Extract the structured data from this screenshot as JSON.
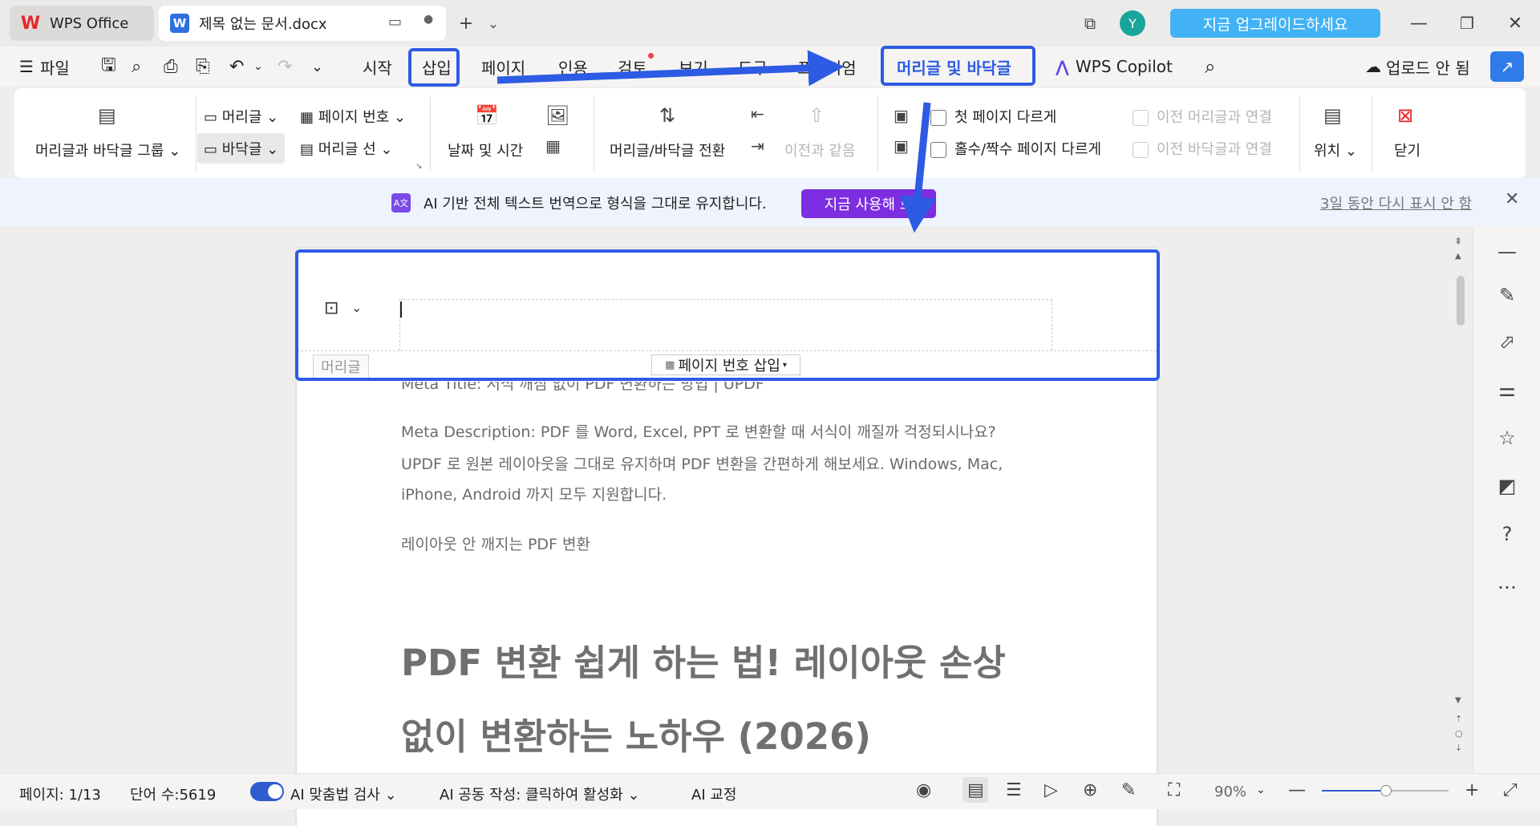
{
  "titlebar": {
    "tab_wps": "WPS Office",
    "tab_doc": "제목 없는 문서.docx",
    "avatar": "Y",
    "upgrade": "지금 업그레이드하세요"
  },
  "menubar": {
    "file": "파일",
    "tabs": [
      "시작",
      "삽입",
      "페이지",
      "인용",
      "검토",
      "보기",
      "도구",
      "프리미엄"
    ],
    "active_tab": "머리글 및 바닥글",
    "copilot": "WPS Copilot",
    "upload": "업로드 안 됨"
  },
  "ribbon": {
    "hf_group": "머리글과 바닥글 그룹",
    "header": "머리글",
    "footer": "바닥글",
    "page_number": "페이지 번호",
    "header_line": "머리글 선",
    "date_time": "날짜 및 시간",
    "switch": "머리글/바닥글 전환",
    "same_as_prev": "이전과 같음",
    "first_page_diff": "첫 페이지 다르게",
    "odd_even_diff": "홀수/짝수 페이지 다르게",
    "link_prev_header": "이전 머리글과 연결",
    "link_prev_footer": "이전 바닥글과 연결",
    "position": "위치",
    "close": "닫기"
  },
  "notification": {
    "badge": "A文",
    "text": "AI 기반 전체 텍스트 번역으로 형식을 그대로 유지합니다.",
    "button": "지금 사용해 보",
    "dismiss": "3일 동안 다시 표시 안 함"
  },
  "document": {
    "header_label": "머리글",
    "insert_page_number": "페이지 번호 삽입",
    "meta_title": "Meta Title: 서식 깨짐 없이 PDF 변환하는 방법 | UPDF",
    "meta_desc_1": "Meta Description: PDF 를 Word, Excel, PPT 로 변환할 때 서식이 깨질까 걱정되시나요?",
    "meta_desc_2": "UPDF 로 원본 레이아웃을 그대로 유지하며 PDF 변환을 간편하게 해보세요. Windows, Mac,",
    "meta_desc_3": "iPhone, Android 까지 모두 지원합니다.",
    "keyword": "레이아웃 안 깨지는 PDF 변환",
    "heading_1": "PDF 변환 쉽게 하는 법! 레이아웃 손상",
    "heading_2": "없이 변환하는 노하우 (2026)"
  },
  "statusbar": {
    "page": "페이지: 1/13",
    "words": "단어 수:5619",
    "spellcheck": "AI 맞춤법 검사",
    "coauthor": "AI 공동 작성: 클릭하여 활성화",
    "proofread": "AI 교정",
    "zoom": "90%",
    "zoom_level": 0.5
  },
  "colors": {
    "highlight": "#2d5be3",
    "upgrade": "#42b2f4",
    "try_button": "#7d2ee0"
  }
}
